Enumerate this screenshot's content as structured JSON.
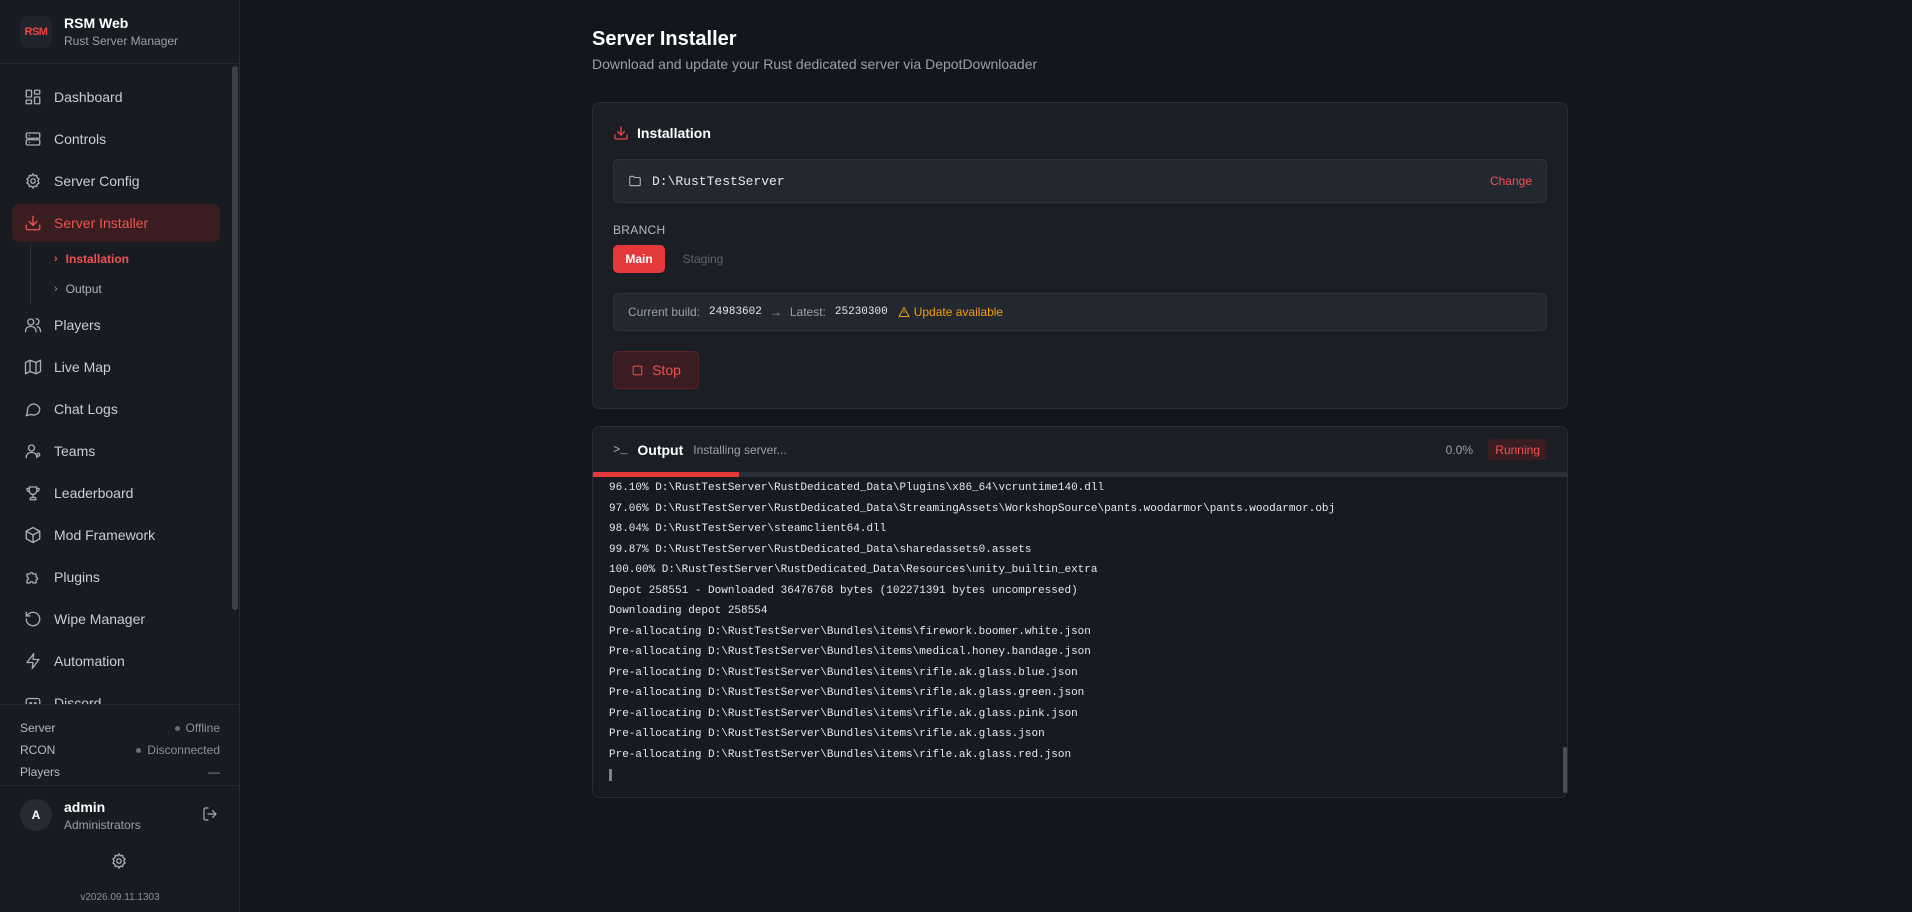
{
  "brand": {
    "logo": "RSM",
    "name": "RSM Web",
    "subtitle": "Rust Server Manager"
  },
  "nav": {
    "items": [
      {
        "label": "Dashboard",
        "icon": "dashboard-icon"
      },
      {
        "label": "Controls",
        "icon": "server-icon"
      },
      {
        "label": "Server Config",
        "icon": "gear-icon"
      },
      {
        "label": "Server Installer",
        "icon": "download-icon",
        "active": true
      },
      {
        "label": "Players",
        "icon": "users-icon"
      },
      {
        "label": "Live Map",
        "icon": "map-icon"
      },
      {
        "label": "Chat Logs",
        "icon": "chat-icon"
      },
      {
        "label": "Teams",
        "icon": "team-icon"
      },
      {
        "label": "Leaderboard",
        "icon": "trophy-icon"
      },
      {
        "label": "Mod Framework",
        "icon": "package-icon"
      },
      {
        "label": "Plugins",
        "icon": "puzzle-icon"
      },
      {
        "label": "Wipe Manager",
        "icon": "refresh-icon"
      },
      {
        "label": "Automation",
        "icon": "lightning-icon"
      },
      {
        "label": "Discord",
        "icon": "discord-icon"
      }
    ],
    "sub_items": [
      {
        "label": "Installation",
        "active": true
      },
      {
        "label": "Output"
      }
    ]
  },
  "status": {
    "server_label": "Server",
    "server_value": "Offline",
    "rcon_label": "RCON",
    "rcon_value": "Disconnected",
    "players_label": "Players",
    "players_value": "—"
  },
  "user": {
    "initial": "A",
    "name": "admin",
    "role": "Administrators"
  },
  "version": "v2026.09.11.1303",
  "page": {
    "title": "Server Installer",
    "subtitle": "Download and update your Rust dedicated server via DepotDownloader"
  },
  "installation": {
    "title": "Installation",
    "path": "D:\\RustTestServer",
    "change_label": "Change",
    "branch_label": "BRANCH",
    "branches": [
      "Main",
      "Staging"
    ],
    "selected_branch": "Main",
    "current_build_label": "Current build:",
    "current_build": "24983602",
    "arrow": "→",
    "latest_label": "Latest:",
    "latest_build": "25230300",
    "update_text": "Update available",
    "stop_label": "Stop"
  },
  "output": {
    "prompt": ">_",
    "title": "Output",
    "status_text": "Installing server...",
    "percent": "0.0%",
    "progress_fraction": 0.15,
    "badge": "Running",
    "lines": [
      "96.10% D:\\RustTestServer\\RustDedicated_Data\\Plugins\\x86_64\\vcruntime140.dll",
      "97.06% D:\\RustTestServer\\RustDedicated_Data\\StreamingAssets\\WorkshopSource\\pants.woodarmor\\pants.woodarmor.obj",
      "98.04% D:\\RustTestServer\\steamclient64.dll",
      "99.87% D:\\RustTestServer\\RustDedicated_Data\\sharedassets0.assets",
      "100.00% D:\\RustTestServer\\RustDedicated_Data\\Resources\\unity_builtin_extra",
      "Depot 258551 - Downloaded 36476768 bytes (102271391 bytes uncompressed)",
      "Downloading depot 258554",
      "Pre-allocating D:\\RustTestServer\\Bundles\\items\\firework.boomer.white.json",
      "Pre-allocating D:\\RustTestServer\\Bundles\\items\\medical.honey.bandage.json",
      "Pre-allocating D:\\RustTestServer\\Bundles\\items\\rifle.ak.glass.blue.json",
      "Pre-allocating D:\\RustTestServer\\Bundles\\items\\rifle.ak.glass.green.json",
      "Pre-allocating D:\\RustTestServer\\Bundles\\items\\rifle.ak.glass.pink.json",
      "Pre-allocating D:\\RustTestServer\\Bundles\\items\\rifle.ak.glass.json",
      "Pre-allocating D:\\RustTestServer\\Bundles\\items\\rifle.ak.glass.red.json"
    ]
  },
  "colors": {
    "accent": "#e5383b",
    "warning": "#f59e0b",
    "background": "#13161c"
  }
}
